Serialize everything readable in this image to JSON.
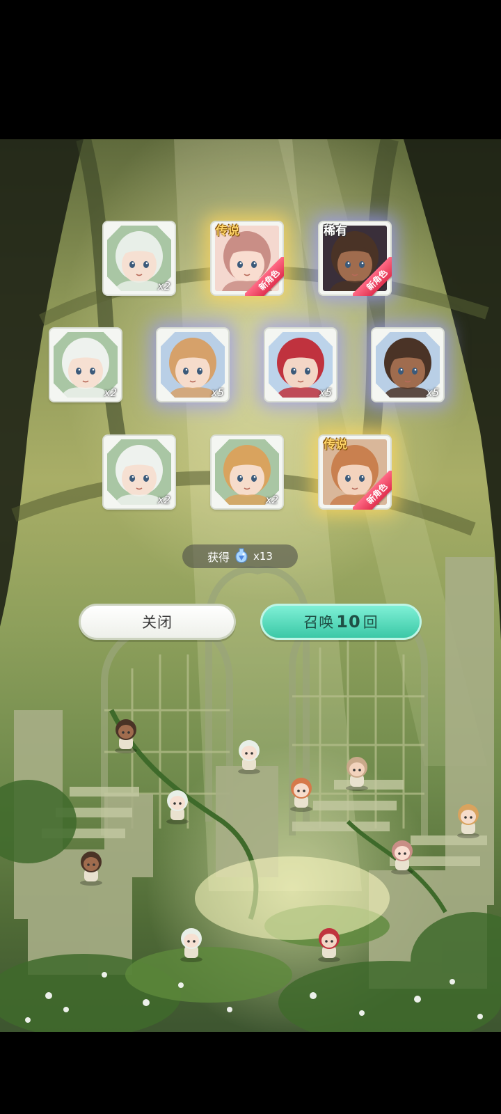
{
  "results": {
    "cards": [
      {
        "id": "c1",
        "rarity_label": "",
        "quantity": "x2",
        "new_label": "",
        "hair": "#e8efe8",
        "skin": "#f6e0d2",
        "bg": "#a9c6a4",
        "glow": "none",
        "shard": true
      },
      {
        "id": "c2",
        "rarity_label": "传说",
        "quantity": "",
        "new_label": "新角色",
        "hair": "#c98e86",
        "skin": "#f9ddd0",
        "bg": "#f4d8cf",
        "glow": "gold",
        "shard": false
      },
      {
        "id": "c3",
        "rarity_label": "稀有",
        "quantity": "",
        "new_label": "新角色",
        "hair": "#4a3326",
        "skin": "#a06c4e",
        "bg": "#3a2f3a",
        "glow": "purple",
        "shard": false
      },
      {
        "id": "c4",
        "rarity_label": "",
        "quantity": "x2",
        "new_label": "",
        "hair": "#eef2ee",
        "skin": "#f6e0d2",
        "bg": "#a9c6a4",
        "glow": "none",
        "shard": true
      },
      {
        "id": "c5",
        "rarity_label": "",
        "quantity": "x5",
        "new_label": "",
        "hair": "#d6a16a",
        "skin": "#f6dccb",
        "bg": "#b9cfe6",
        "glow": "purple",
        "shard": true
      },
      {
        "id": "c6",
        "rarity_label": "",
        "quantity": "x5",
        "new_label": "",
        "hair": "#c0323e",
        "skin": "#f3d6c6",
        "bg": "#bcd3ea",
        "glow": "purple",
        "shard": true
      },
      {
        "id": "c7",
        "rarity_label": "",
        "quantity": "x5",
        "new_label": "",
        "hair": "#4a3326",
        "skin": "#a06c4e",
        "bg": "#b9cfe6",
        "glow": "purple",
        "shard": true
      },
      {
        "id": "c8",
        "rarity_label": "",
        "quantity": "x2",
        "new_label": "",
        "hair": "#eef2ee",
        "skin": "#f6e0d2",
        "bg": "#a9c6a4",
        "glow": "none",
        "shard": true
      },
      {
        "id": "c9",
        "rarity_label": "",
        "quantity": "x2",
        "new_label": "",
        "hair": "#d9a35e",
        "skin": "#f6dccb",
        "bg": "#a9c6a4",
        "glow": "none",
        "shard": true
      },
      {
        "id": "c10",
        "rarity_label": "传说",
        "quantity": "",
        "new_label": "新角色",
        "hair": "#c9804f",
        "skin": "#f3d3bd",
        "bg": "#d9b79a",
        "glow": "gold",
        "shard": false
      }
    ]
  },
  "obtain": {
    "label": "获得",
    "count": "x13",
    "item_icon": "gem-bottle-icon"
  },
  "buttons": {
    "close_label": "关闭",
    "summon_prefix": "召唤",
    "summon_count": "10",
    "summon_suffix": "回"
  },
  "colors": {
    "summon_button": "#3bc8a6",
    "close_button": "#ffffff",
    "legend_label": "#ffd56a",
    "new_ribbon": "#e0304f"
  }
}
